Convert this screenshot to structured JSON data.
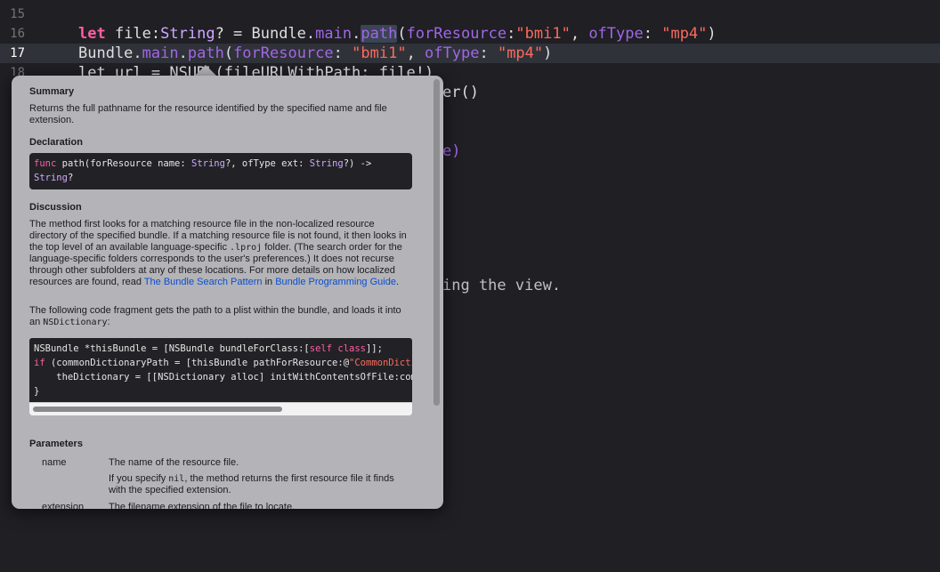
{
  "editor": {
    "lines": [
      {
        "num": "15"
      },
      {
        "num": "16",
        "text": {
          "let": "let",
          "file": " file:",
          "type": "String",
          "rest": "? = Bundle.",
          "main": "main",
          "dot": ".",
          "path": "path",
          "paren": "(",
          "fr": "forResource",
          "colon": ":",
          "s1": "\"bmi1\"",
          "comma": ", ",
          "ot": "ofType",
          "colon2": ": ",
          "s2": "\"mp4\"",
          "close": ")"
        }
      },
      {
        "num": "17",
        "text": {
          "bundle": "Bundle.",
          "main": "main",
          "dot": ".",
          "path": "path",
          "paren": "(",
          "fr": "forResource",
          "colon": ": ",
          "s1": "\"bmi1\"",
          "comma": ", ",
          "ot": "ofType",
          "colon2": ": ",
          "s2": "\"mp4\"",
          "close": ")"
        }
      },
      {
        "num": "18",
        "text": {
          "frag": "let url = NSURL(fileURLWithPath: file!)"
        }
      }
    ],
    "peek_fragments": {
      "er": "er()",
      "e": "e)",
      "view": "ing the view."
    }
  },
  "popover": {
    "summary_heading": "Summary",
    "summary_text": "Returns the full pathname for the resource identified by the specified name and file extension.",
    "declaration_heading": "Declaration",
    "declaration": {
      "func": "func",
      "sig1": " path(forResource name: ",
      "t1": "String",
      "sig2": "?, ofType ext: ",
      "t2": "String",
      "sig3": "?) ->",
      "t3": "String",
      "sig4": "?"
    },
    "discussion_heading": "Discussion",
    "discussion_p1_a": "The method first looks for a matching resource file in the non-localized resource directory of the specified bundle. If a matching resource file is not found, it then looks in the top level of an available language-specific ",
    "discussion_p1_code": ".lproj",
    "discussion_p1_b": " folder. (The search order for the language-specific folders corresponds to the user's preferences.) It does not recurse through other subfolders at any of these locations. For more details on how localized resources are found, read ",
    "discussion_link1": "The Bundle Search Pattern",
    "discussion_p1_c": " in ",
    "discussion_link2": "Bundle Programming Guide",
    "discussion_p1_d": ".",
    "discussion_p2_a": "The following code fragment gets the path to a plist within the bundle, and loads it into an ",
    "discussion_p2_code": "NSDictionary",
    "discussion_p2_b": ":",
    "code_lines": {
      "l1_a": "NSBundle *thisBundle = [NSBundle bundleForClass:[",
      "l1_kw": "self class",
      "l1_b": "]];",
      "l2_kw": "if",
      "l2_a": " (commonDictionaryPath = [thisBundle pathForResource:@",
      "l2_str": "\"CommonDictionary\"",
      "l3": "    theDictionary = [[NSDictionary alloc] initWithContentsOfFile:commonDictionaryPath];",
      "l4": "}"
    },
    "parameters_heading": "Parameters",
    "params": [
      {
        "name": "name",
        "desc1": "The name of the resource file.",
        "desc2_a": "If you specify ",
        "desc2_code": "nil",
        "desc2_b": ", the method returns the first resource file it finds with the specified extension."
      },
      {
        "name": "extension",
        "desc1": "The filename extension of the file to locate."
      }
    ]
  }
}
